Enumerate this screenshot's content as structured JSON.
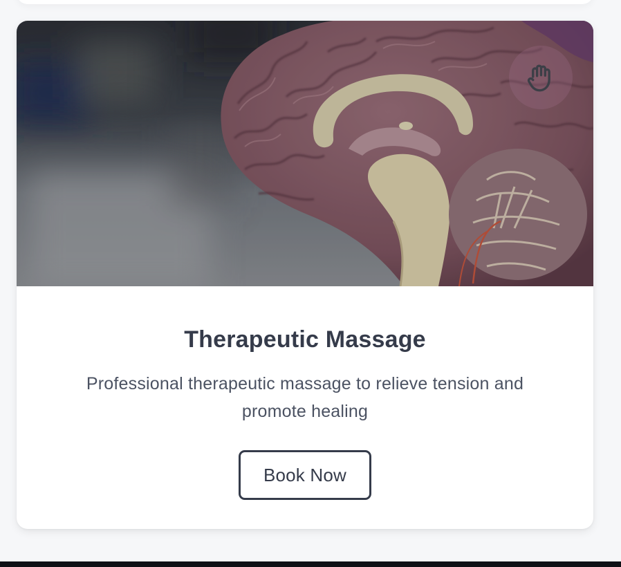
{
  "card": {
    "title": "Therapeutic Massage",
    "description": "Professional therapeutic massage to relieve tension and promote healing",
    "button_label": "Book Now",
    "icon": "hand-icon"
  },
  "colors": {
    "page_background": "#f6f7f9",
    "card_background": "#ffffff",
    "text_dark": "#353b4a",
    "text_muted": "#4b5262",
    "footer": "#0f1116"
  }
}
